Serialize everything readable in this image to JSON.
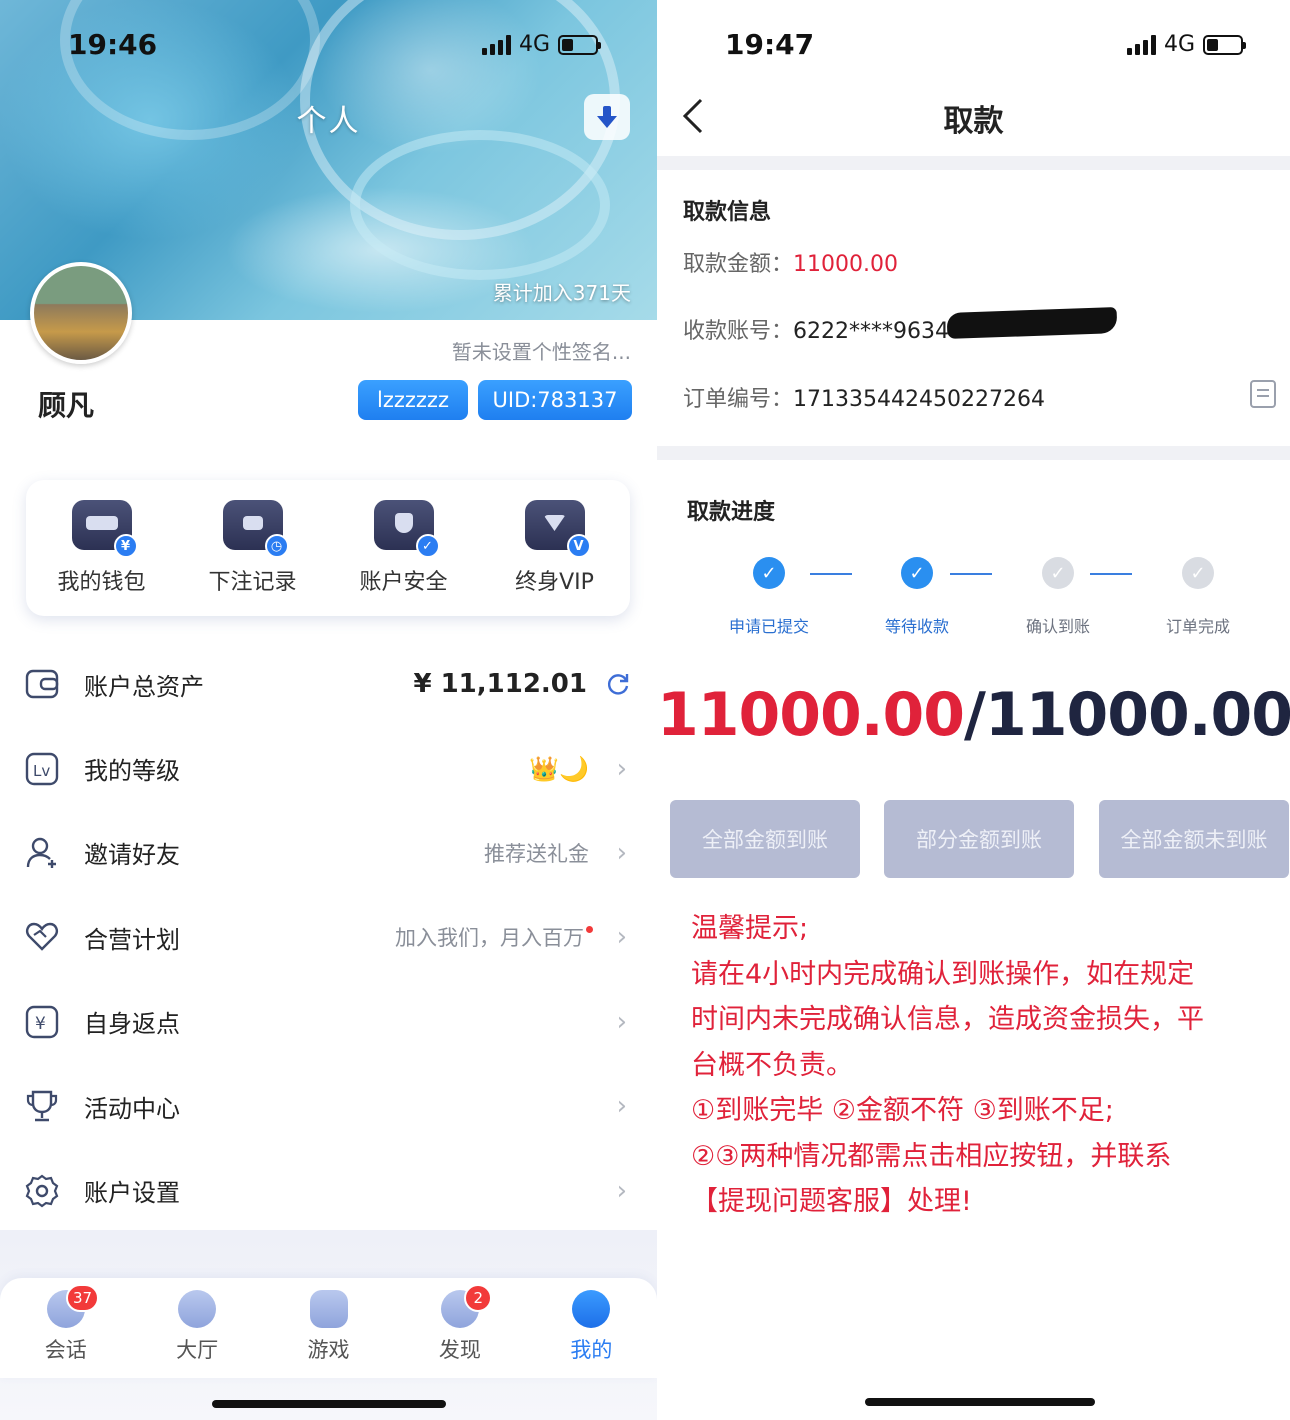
{
  "left_screen": {
    "status_bar": {
      "time": "19:46",
      "network": "4G"
    },
    "header": {
      "title": "个人",
      "joined_text": "累计加入371天",
      "signature": "暂未设置个性签名...",
      "username": "顾凡",
      "tag_name": "lzzzzzz",
      "tag_uid": "UID:783137"
    },
    "quick_actions": [
      {
        "label": "我的钱包",
        "icon": "wallet-icon",
        "badge": "¥"
      },
      {
        "label": "下注记录",
        "icon": "bet-record-icon",
        "badge": "◷"
      },
      {
        "label": "账户安全",
        "icon": "shield-icon",
        "badge": "✓"
      },
      {
        "label": "终身VIP",
        "icon": "vip-diamond-icon",
        "badge": "V"
      }
    ],
    "menu": {
      "assets": {
        "label": "账户总资产",
        "value": "¥ 11,112.01"
      },
      "level": {
        "label": "我的等级",
        "badges": "👑🌙"
      },
      "invite": {
        "label": "邀请好友",
        "hint": "推荐送礼金"
      },
      "partner": {
        "label": "合营计划",
        "hint": "加入我们，月入百万"
      },
      "rebate": {
        "label": "自身返点"
      },
      "activity": {
        "label": "活动中心"
      },
      "settings": {
        "label": "账户设置"
      }
    },
    "tabbar": [
      {
        "label": "会话",
        "icon": "chat-icon",
        "badge": "37"
      },
      {
        "label": "大厅",
        "icon": "home-icon",
        "badge": ""
      },
      {
        "label": "游戏",
        "icon": "gamepad-icon",
        "badge": ""
      },
      {
        "label": "发现",
        "icon": "compass-icon",
        "badge": "2"
      },
      {
        "label": "我的",
        "icon": "profile-icon",
        "badge": "",
        "active": true
      }
    ]
  },
  "right_screen": {
    "status_bar": {
      "time": "19:47",
      "network": "4G"
    },
    "nav": {
      "title": "取款"
    },
    "info": {
      "section_title": "取款信息",
      "amount_label": "取款金额：",
      "amount_value": "11000.00",
      "account_label": "收款账号：",
      "account_value": "6222****9634",
      "order_label": "订单编号：",
      "order_value": "171335442450227264"
    },
    "progress": {
      "section_title": "取款进度",
      "steps": [
        {
          "label": "申请已提交",
          "done": true
        },
        {
          "label": "等待收款",
          "done": true
        },
        {
          "label": "确认到账",
          "done": false
        },
        {
          "label": "订单完成",
          "done": false
        }
      ],
      "paid": "11000.00",
      "separator": "/",
      "total": "11000.00"
    },
    "actions": {
      "full": "全部金额到账",
      "partial": "部分金额到账",
      "none": "全部金额未到账"
    },
    "notice": [
      "温馨提示;",
      "请在4小时内完成确认到账操作，如在规定",
      "时间内未完成确认信息，造成资金损失，平",
      "台概不负责。",
      "①到账完毕 ②金额不符 ③到账不足;",
      "②③两种情况都需点击相应按钮，并联系",
      "【提现问题客服】处理!"
    ]
  },
  "colors": {
    "accent_blue": "#2b7df2",
    "alert_red": "#e0223a",
    "disabled_button": "#b5bbd3"
  }
}
